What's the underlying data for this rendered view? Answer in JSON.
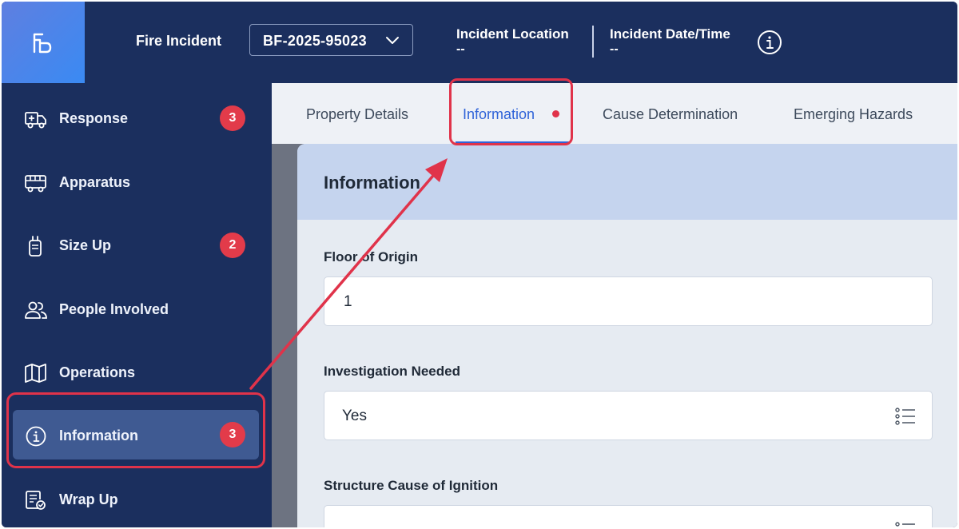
{
  "header": {
    "title": "Fire Incident",
    "incident_id": "BF-2025-95023",
    "location_label": "Incident Location",
    "location_value": "--",
    "datetime_label": "Incident Date/Time",
    "datetime_value": "--"
  },
  "sidebar": {
    "items": [
      {
        "label": "Response",
        "icon": "fire-truck-icon",
        "badge": "3"
      },
      {
        "label": "Apparatus",
        "icon": "bus-icon",
        "badge": ""
      },
      {
        "label": "Size Up",
        "icon": "radio-icon",
        "badge": "2"
      },
      {
        "label": "People Involved",
        "icon": "people-icon",
        "badge": ""
      },
      {
        "label": "Operations",
        "icon": "map-icon",
        "badge": ""
      },
      {
        "label": "Information",
        "icon": "info-icon",
        "badge": "3"
      },
      {
        "label": "Wrap Up",
        "icon": "checklist-icon",
        "badge": ""
      }
    ],
    "active": "Information"
  },
  "tabs": [
    {
      "label": "Property Details"
    },
    {
      "label": "Information"
    },
    {
      "label": "Cause Determination"
    },
    {
      "label": "Emerging Hazards"
    }
  ],
  "panel": {
    "title": "Information",
    "fields": [
      {
        "label": "Floor of Origin",
        "value": "1"
      },
      {
        "label": "Investigation Needed",
        "value": "Yes"
      },
      {
        "label": "Structure Cause of Ignition",
        "value": ""
      }
    ]
  },
  "colors": {
    "navy": "#1b2f5e",
    "accent": "#2f63d8",
    "badge": "#e23b4a",
    "highlight": "#e0334a"
  }
}
